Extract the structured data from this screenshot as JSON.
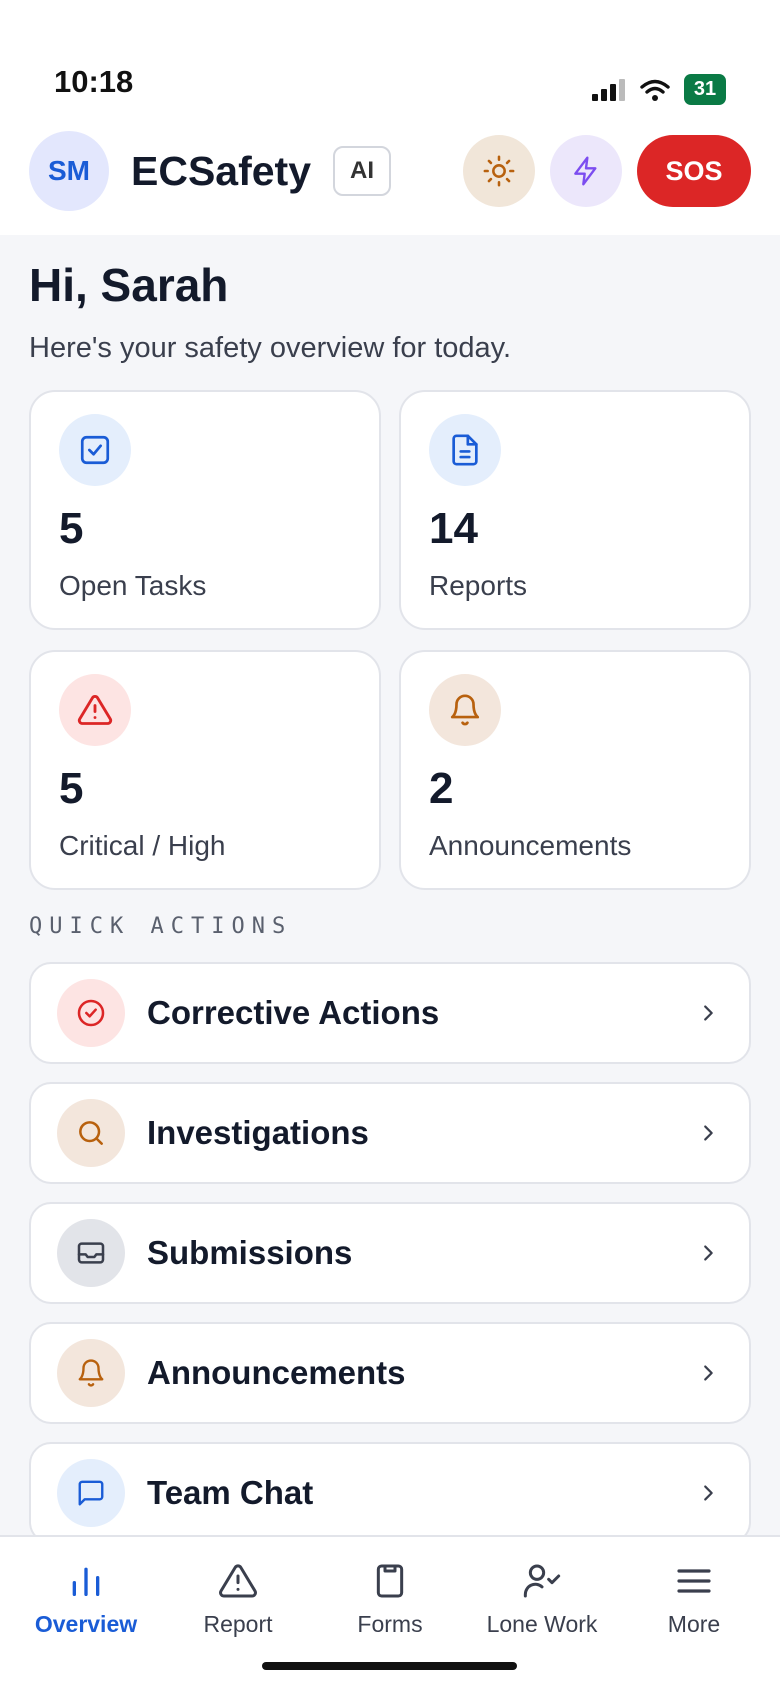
{
  "status_bar": {
    "time": "10:18",
    "battery": "31"
  },
  "header": {
    "avatar_initials": "SM",
    "app_title": "ECSafety",
    "ai_badge": "AI",
    "sos_label": "SOS"
  },
  "greeting": {
    "title": "Hi, Sarah",
    "subtitle": "Here's your safety overview for today."
  },
  "stats": [
    {
      "value": "5",
      "label": "Open Tasks",
      "icon": "check-square-icon",
      "bg": "#e4eefc",
      "fg": "#1a5cd6"
    },
    {
      "value": "14",
      "label": "Reports",
      "icon": "file-text-icon",
      "bg": "#e4eefc",
      "fg": "#1a5cd6"
    },
    {
      "value": "5",
      "label": "Critical / High",
      "icon": "alert-triangle-icon",
      "bg": "#fde4e3",
      "fg": "#dc2626"
    },
    {
      "value": "2",
      "label": "Announcements",
      "icon": "bell-icon",
      "bg": "#f3e6dc",
      "fg": "#b8610e"
    }
  ],
  "quick_actions": {
    "title": "QUICK ACTIONS",
    "items": [
      {
        "label": "Corrective Actions",
        "icon": "check-circle-icon"
      },
      {
        "label": "Investigations",
        "icon": "search-icon"
      },
      {
        "label": "Submissions",
        "icon": "inbox-icon"
      },
      {
        "label": "Announcements",
        "icon": "bell-icon"
      },
      {
        "label": "Team Chat",
        "icon": "message-square-icon"
      }
    ]
  },
  "nav": [
    {
      "label": "Overview",
      "icon": "bar-chart-icon",
      "active": true
    },
    {
      "label": "Report",
      "icon": "alert-triangle-icon"
    },
    {
      "label": "Forms",
      "icon": "clipboard-icon"
    },
    {
      "label": "Lone Work",
      "icon": "user-check-icon"
    },
    {
      "label": "More",
      "icon": "menu-icon"
    }
  ],
  "colors": {
    "accent": "#1a5cd6",
    "sos": "#dc2626",
    "battery": "#0a7a45"
  }
}
